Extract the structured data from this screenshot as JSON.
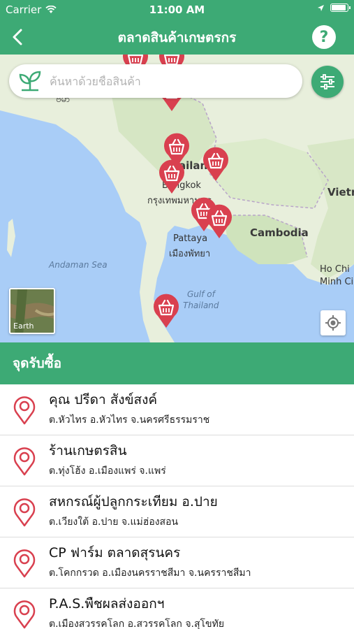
{
  "status_bar": {
    "carrier": "Carrier",
    "time": "11:00 AM"
  },
  "nav": {
    "title": "ตลาดสินค้าเกษตรกร",
    "help_label": "?"
  },
  "search": {
    "placeholder": "ค้นหาด้วยชื่อสินค้า"
  },
  "map": {
    "labels": {
      "myanmar": "ဗမာ",
      "thailand": "ailan",
      "bangkok": "Bangkok",
      "bangkok_th": "กรุงเทพมหานคร",
      "pattaya": "Pattaya",
      "pattaya_th": "เมืองพัทยา",
      "cambodia": "Cambodia",
      "andaman": "Andaman Sea",
      "gulf1": "Gulf of",
      "gulf2": "Thailand",
      "vietnam": "Vietn",
      "hcm1": "Ho Chi",
      "hcm2": "Minh Ci"
    },
    "earth_label": "Earth"
  },
  "section": {
    "title": "จุดรับซื้อ"
  },
  "locations": [
    {
      "name": "คุณ ปรีดา  สังข์สงค์",
      "address": "ต.หัวไทร อ.หัวไทร จ.นครศรีธรรมราช"
    },
    {
      "name": "ร้านเกษตรสิน",
      "address": "ต.ทุ่งโฮ้ง อ.เมืองแพร่ จ.แพร่"
    },
    {
      "name": "สหกรณ์ผู้ปลูกกระเทียม อ.ปาย",
      "address": "ต.เวียงใต้ อ.ปาย จ.แม่ฮ่องสอน"
    },
    {
      "name": "CP ฟาร์ม ตลาดสุรนคร",
      "address": "ต.โคกกรวด อ.เมืองนครราชสีมา จ.นครราชสีมา"
    },
    {
      "name": "P.A.S.พืชผลส่งออกฯ",
      "address": "ต.เมืองสวรรคโลก อ.สวรรคโลก จ.สุโขทัย"
    }
  ],
  "colors": {
    "brand_green": "#3daa75",
    "pin_red": "#d9404f",
    "sea": "#a9cdf7",
    "land": "#e8efdc"
  },
  "icons": {
    "back": "chevron-left-icon",
    "help": "question-icon",
    "leaf": "leaf-icon",
    "filter": "sliders-icon",
    "pin": "map-pin-icon",
    "basket": "basket-icon",
    "locate": "crosshair-icon"
  }
}
